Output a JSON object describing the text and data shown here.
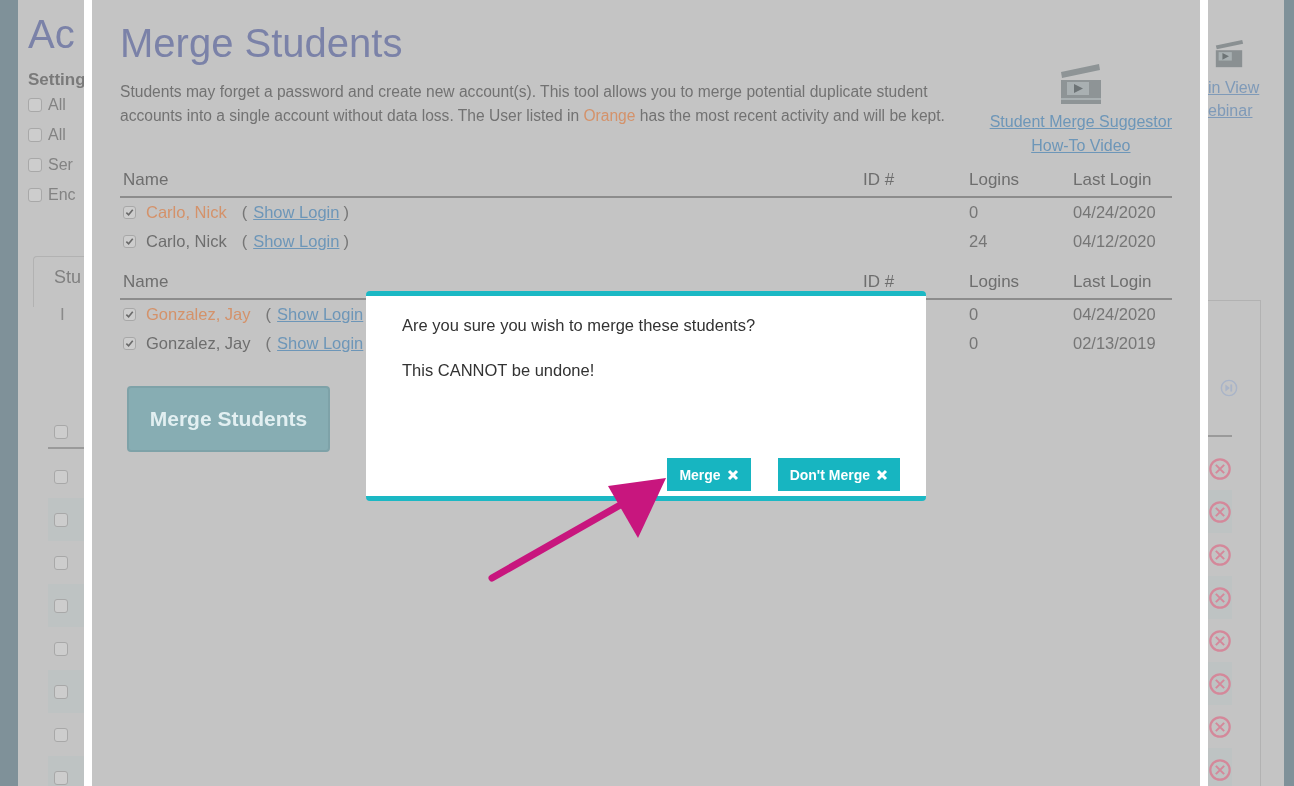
{
  "background_page": {
    "title": "Ac",
    "settings_label": "Setting",
    "settings": [
      {
        "label": "All",
        "checked": false
      },
      {
        "label": "All",
        "checked": false
      },
      {
        "label": "Ser",
        "checked": false
      },
      {
        "label": "Enc",
        "checked": false
      }
    ],
    "panel": {
      "title": "Stu",
      "text": "I",
      "header_checked": false,
      "rows": [
        {
          "checked": false
        },
        {
          "checked": false
        },
        {
          "checked": false
        },
        {
          "checked": false
        },
        {
          "checked": false
        },
        {
          "checked": false
        },
        {
          "checked": false
        },
        {
          "checked": false
        }
      ]
    },
    "webinar_link": [
      "in View",
      "ebinar"
    ]
  },
  "modal": {
    "title": "Merge Students",
    "description": [
      {
        "text": "Students may forget a password and create new account(s). This tool allows you to merge potential duplicate student accounts into a single account without data loss. The User listed in ",
        "highlight": false
      },
      {
        "text": "Orange",
        "highlight": true
      },
      {
        "text": " has the most recent activity and will be kept.",
        "highlight": false
      }
    ],
    "video_link": [
      "Student Merge Suggestor",
      "How-To Video"
    ],
    "groups": [
      {
        "columns": [
          "Name",
          "ID #",
          "Logins",
          "Last Login"
        ],
        "rows": [
          {
            "name": "Carlo, Nick",
            "checked": true,
            "kept": true,
            "open_paren": "(",
            "link": "Show Login",
            "close_paren": ")",
            "logins": "0",
            "last_login": "04/24/2020"
          },
          {
            "name": "Carlo, Nick",
            "checked": true,
            "kept": false,
            "open_paren": "(",
            "link": "Show Login",
            "close_paren": ")",
            "logins": "24",
            "last_login": "04/12/2020"
          }
        ]
      },
      {
        "columns": [
          "Name",
          "ID #",
          "Logins",
          "Last Login"
        ],
        "rows": [
          {
            "name": "Gonzalez, Jay",
            "checked": true,
            "kept": true,
            "open_paren": "(",
            "link": "Show Login",
            "logins": "0",
            "last_login": "04/24/2020"
          },
          {
            "name": "Gonzalez, Jay",
            "checked": true,
            "kept": false,
            "open_paren": "(",
            "link": "Show Login",
            "logins": "0",
            "last_login": "02/13/2019"
          }
        ]
      }
    ],
    "merge_button": "Merge Students"
  },
  "dialog": {
    "messages": [
      "Are you sure you wish to merge these students?",
      "This CANNOT be undone!"
    ],
    "buttons": [
      "Merge",
      "Don't Merge"
    ]
  }
}
